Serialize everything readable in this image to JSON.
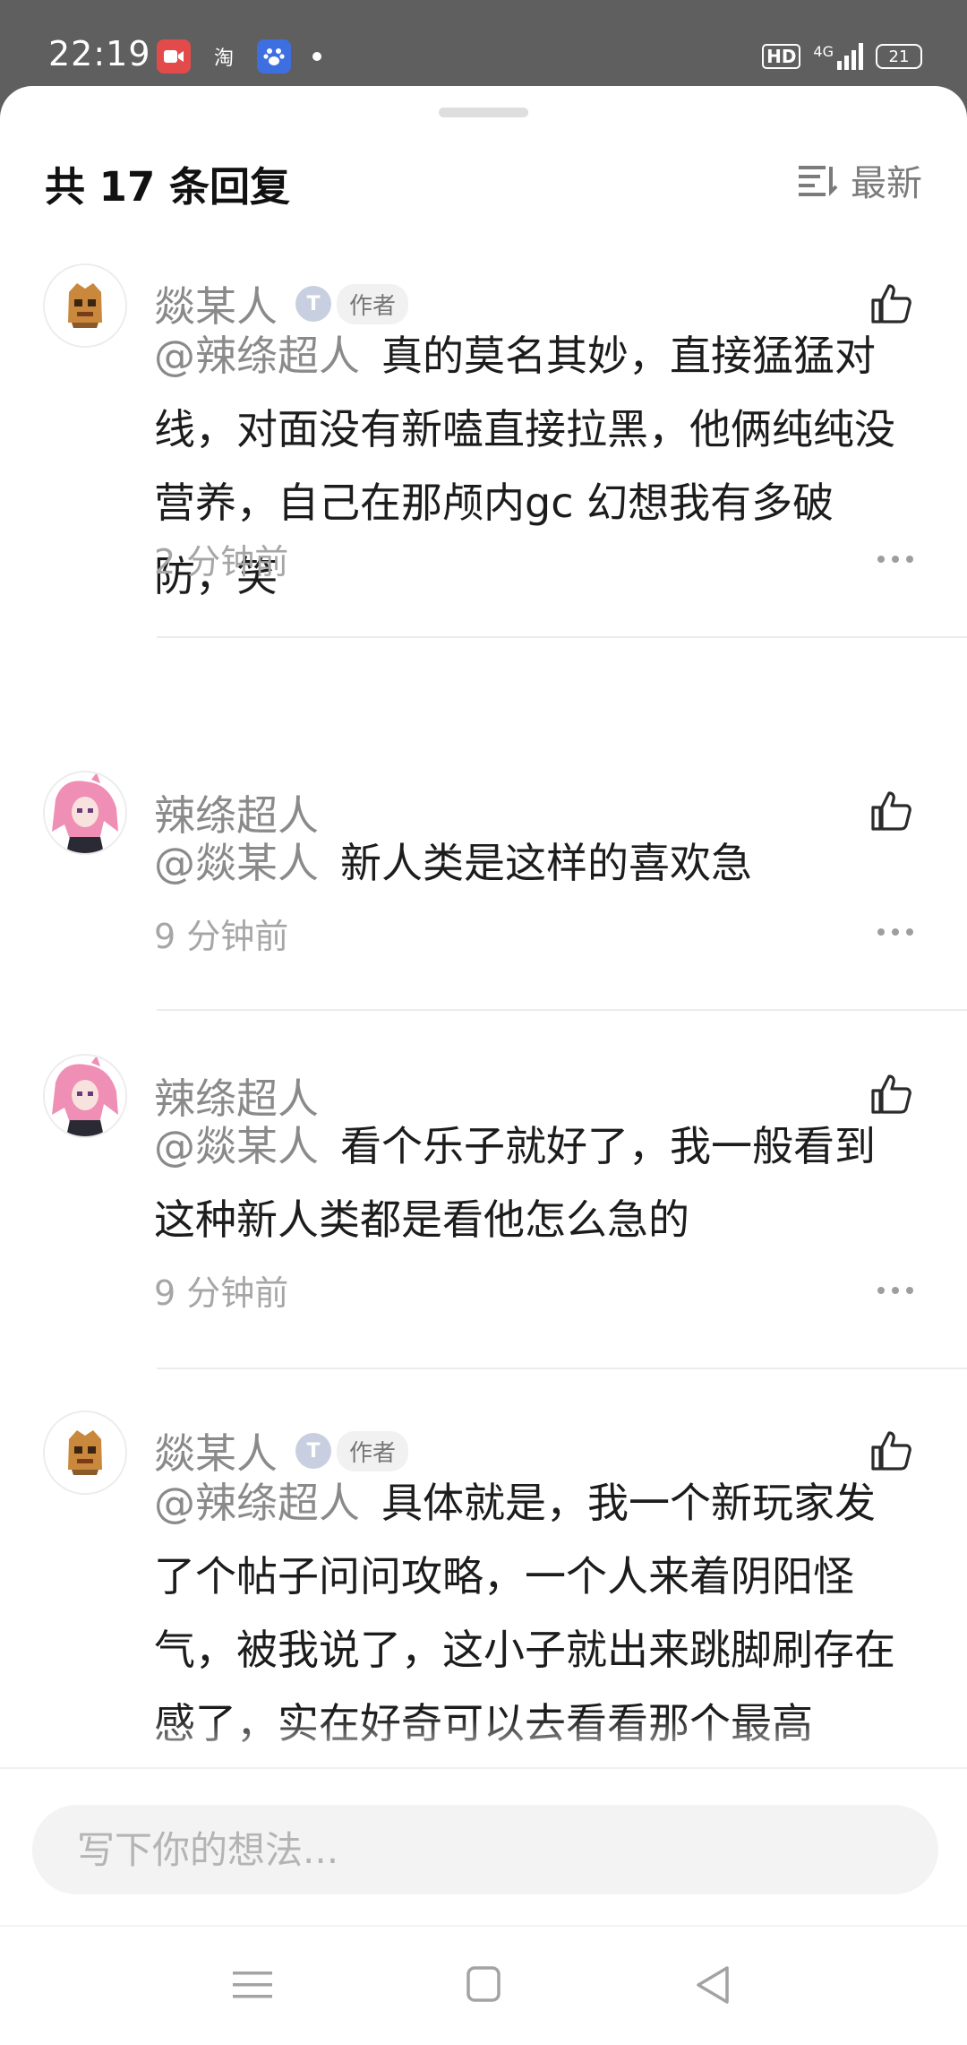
{
  "status_bar": {
    "time": "22:19",
    "app_icons": [
      {
        "name": "video-recorder-icon",
        "glyph": "■",
        "bg": "#e34b4b"
      },
      {
        "name": "taobao-icon",
        "glyph": "淘",
        "bg": "#5f5f5f"
      },
      {
        "name": "baidu-icon",
        "glyph": "度",
        "bg": "#3d6fe0"
      }
    ],
    "hd_label": "HD",
    "network_label": "4G",
    "battery": "21"
  },
  "header": {
    "title": "共 17 条回复",
    "sort_label": "最新"
  },
  "comments": [
    {
      "username": "燚某人",
      "level_badge": "T",
      "author_badge": "作者",
      "mention": "@辣绦超人",
      "text": "真的莫名其妙，直接猛猛对线，对面没有新嗑直接拉黑，他俩纯纯没营养，自己在那颅内gc 幻想我有多破防，笑",
      "time": "2 分钟前"
    },
    {
      "username": "辣绦超人",
      "mention": "@燚某人",
      "text": "新人类是这样的喜欢急",
      "time": "9 分钟前"
    },
    {
      "username": "辣绦超人",
      "mention": "@燚某人",
      "text": "看个乐子就好了，我一般看到这种新人类都是看他怎么急的",
      "time": "9 分钟前"
    },
    {
      "username": "燚某人",
      "level_badge": "T",
      "author_badge": "作者",
      "mention": "@辣绦超人",
      "text": "具体就是，我一个新玩家发了个帖子问问攻略，一个人来着阴阳怪气，被我说了，这小子就出来跳脚刷存在感了，实在好奇可以去看看那个最高"
    }
  ],
  "input": {
    "placeholder": "写下你的想法..."
  },
  "colors": {
    "username": "#8a8a8a",
    "text": "#1c1c1c",
    "meta": "#a6a6a6",
    "status_bar_bg": "#5f5f5f"
  }
}
